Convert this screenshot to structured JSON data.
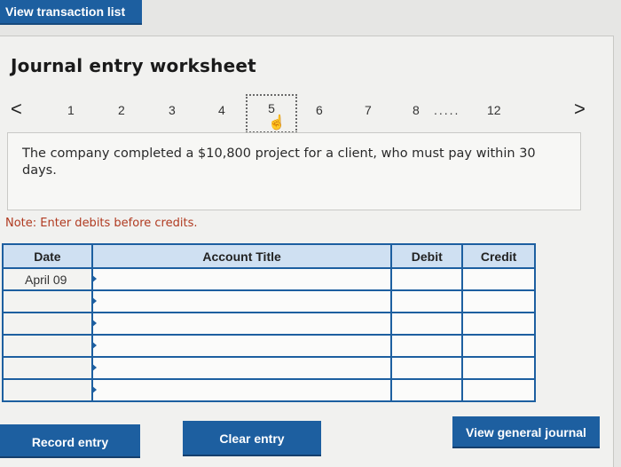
{
  "top_button": "View transaction list",
  "title": "Journal entry worksheet",
  "pager": {
    "prev": "<",
    "next": ">",
    "pages": [
      "1",
      "2",
      "3",
      "4",
      "5",
      "6",
      "7",
      "8",
      "12"
    ],
    "ellipsis": ".....",
    "active": "5"
  },
  "description": "The company completed a $10,800 project for a client, who must pay within 30 days.",
  "note": "Note: Enter debits before credits.",
  "table": {
    "headers": {
      "date": "Date",
      "account": "Account Title",
      "debit": "Debit",
      "credit": "Credit"
    },
    "rows": [
      {
        "date": "April 09",
        "account": "",
        "debit": "",
        "credit": ""
      },
      {
        "date": "",
        "account": "",
        "debit": "",
        "credit": ""
      },
      {
        "date": "",
        "account": "",
        "debit": "",
        "credit": ""
      },
      {
        "date": "",
        "account": "",
        "debit": "",
        "credit": ""
      },
      {
        "date": "",
        "account": "",
        "debit": "",
        "credit": ""
      },
      {
        "date": "",
        "account": "",
        "debit": "",
        "credit": ""
      }
    ]
  },
  "buttons": {
    "record": "Record entry",
    "clear": "Clear entry",
    "view_journal": "View general journal"
  },
  "colors": {
    "accent": "#1d5fa0",
    "header_bg": "#cfe0f2",
    "note": "#b03a20"
  }
}
